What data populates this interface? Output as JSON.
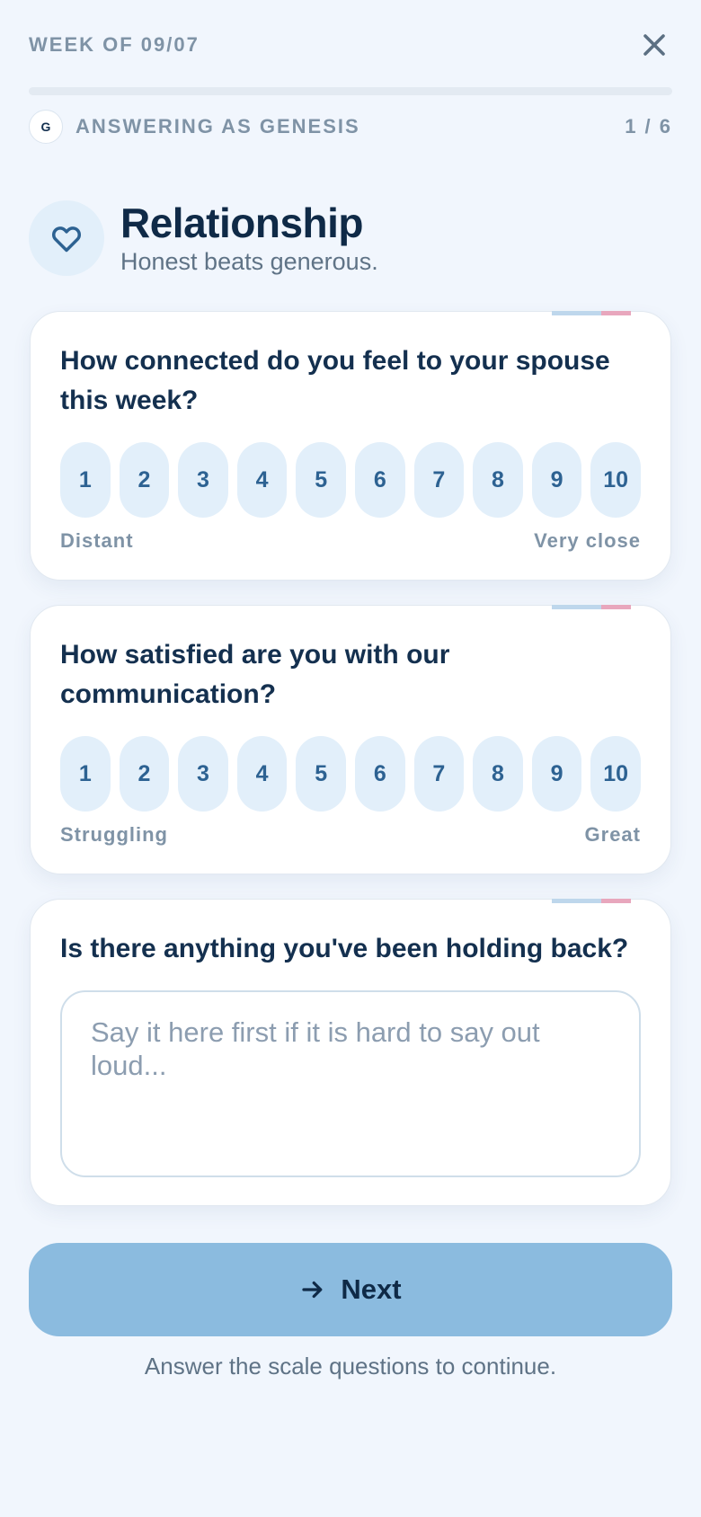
{
  "header": {
    "week_label": "WEEK OF 09/07",
    "close_icon": "close-icon"
  },
  "progress": {
    "current": 1,
    "total": 6,
    "fraction": 0.0
  },
  "answering": {
    "avatar_initial": "G",
    "label": "ANSWERING AS GENESIS",
    "step": "1 / 6"
  },
  "section": {
    "icon": "heart-icon",
    "title": "Relationship",
    "subtitle": "Honest beats generous."
  },
  "questions": [
    {
      "text": "How connected do you feel to your spouse this week?",
      "scale": [
        "1",
        "2",
        "3",
        "4",
        "5",
        "6",
        "7",
        "8",
        "9",
        "10"
      ],
      "low_label": "Distant",
      "high_label": "Very close"
    },
    {
      "text": "How satisfied are you with our communication?",
      "scale": [
        "1",
        "2",
        "3",
        "4",
        "5",
        "6",
        "7",
        "8",
        "9",
        "10"
      ],
      "low_label": "Struggling",
      "high_label": "Great"
    },
    {
      "text": "Is there anything you've been holding back?",
      "value": "",
      "placeholder": "Say it here first if it is hard to say out loud..."
    }
  ],
  "footer": {
    "next_label": "Next",
    "next_icon": "arrow-right-icon",
    "hint": "Answer the scale questions to continue."
  },
  "colors": {
    "background": "#f1f6fd",
    "accent": "#8bbbdf",
    "chip": "#e2effa",
    "text": "#14304f",
    "muted": "#7f93a6",
    "accent_pink": "#e8a7bd"
  }
}
